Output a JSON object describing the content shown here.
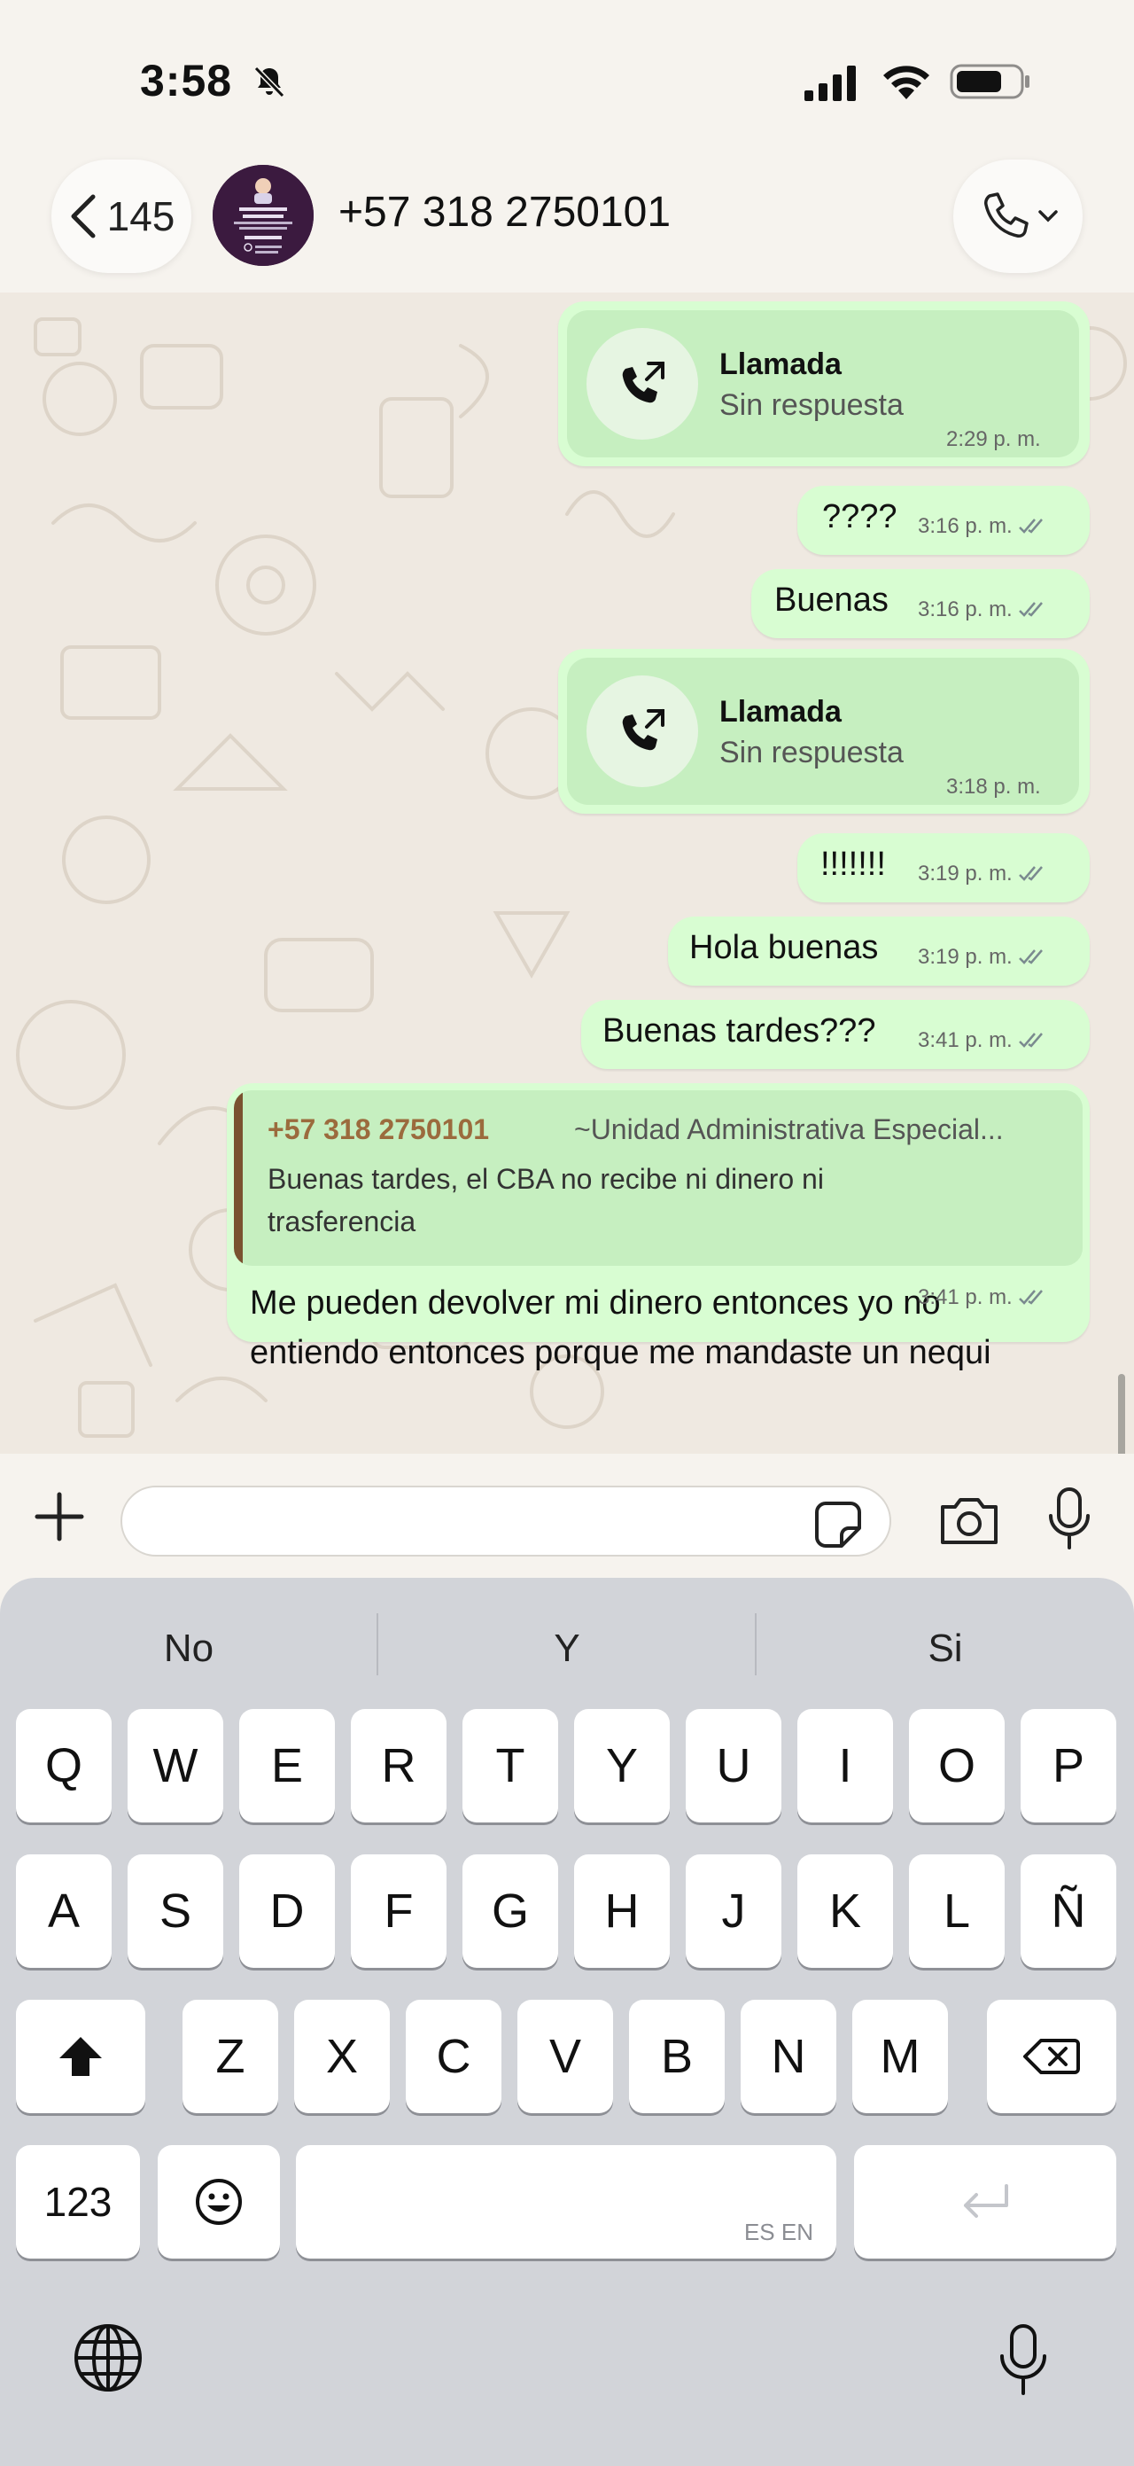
{
  "status_bar": {
    "time": "3:58"
  },
  "header": {
    "back_count": "145",
    "contact_name": "+57 318 2750101"
  },
  "messages": [
    {
      "type": "call",
      "title": "Llamada",
      "subtitle": "Sin respuesta",
      "time": "2:29 p. m."
    },
    {
      "type": "text",
      "text": "????",
      "time": "3:16 p. m.",
      "read": true
    },
    {
      "type": "text",
      "text": "Buenas",
      "time": "3:16 p. m.",
      "read": true
    },
    {
      "type": "call",
      "title": "Llamada",
      "subtitle": "Sin respuesta",
      "time": "3:18 p. m."
    },
    {
      "type": "text",
      "text": "!!!!!!!",
      "time": "3:19 p. m.",
      "read": true
    },
    {
      "type": "text",
      "text": "Hola buenas",
      "time": "3:19 p. m.",
      "read": true
    },
    {
      "type": "text",
      "text": "Buenas tardes???",
      "time": "3:41 p. m.",
      "read": true
    },
    {
      "type": "reply",
      "quote_sender": "+57 318 2750101",
      "quote_group": "~Unidad Administrativa Especial...",
      "quote_text": "Buenas tardes, el CBA no recibe ni dinero ni trasferencia",
      "text": "Me pueden devolver mi dinero entonces yo no entiendo entonces porque me mandaste un nequi",
      "time": "3:41 p. m.",
      "read": true
    }
  ],
  "composer": {
    "value": "",
    "placeholder": ""
  },
  "keyboard": {
    "suggestions": [
      "No",
      "Y",
      "Si"
    ],
    "row1": [
      "Q",
      "W",
      "E",
      "R",
      "T",
      "Y",
      "U",
      "I",
      "O",
      "P"
    ],
    "row2": [
      "A",
      "S",
      "D",
      "F",
      "G",
      "H",
      "J",
      "K",
      "L",
      "Ñ"
    ],
    "row3": [
      "Z",
      "X",
      "C",
      "V",
      "B",
      "N",
      "M"
    ],
    "numbers_label": "123",
    "space_lang": "ES EN"
  },
  "colors": {
    "bubble": "#d8fdd2",
    "call_card": "#c6efc0",
    "quote_bar": "#7a5230",
    "quote_sender": "#9b6b3d",
    "read_ticks": "#7a8a8f"
  }
}
